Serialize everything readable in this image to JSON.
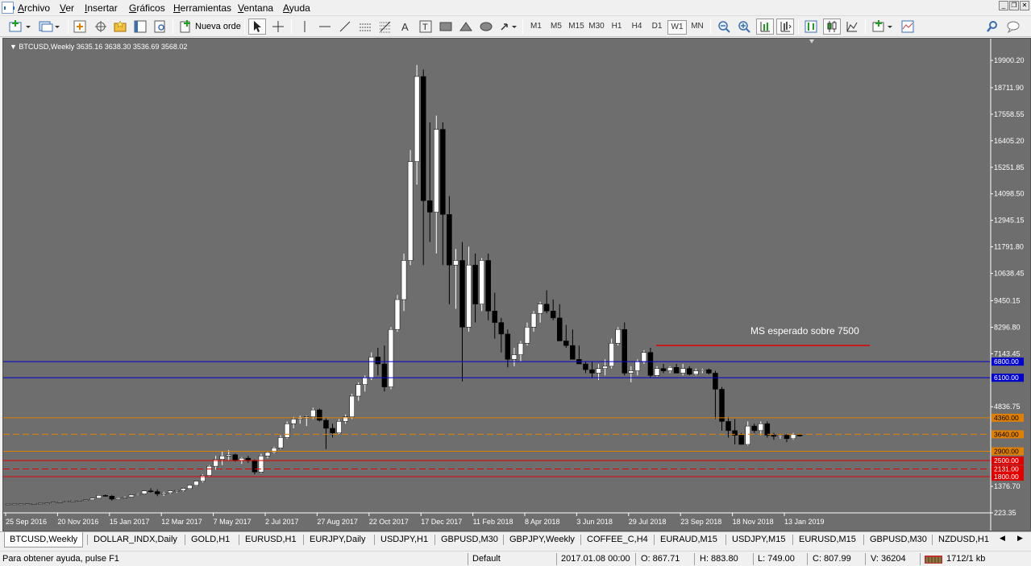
{
  "menu": [
    "Archivo",
    "Ver",
    "Insertar",
    "Gráficos",
    "Herramientas",
    "Ventana",
    "Ayuda"
  ],
  "toolbar": {
    "new_order_label": "Nueva orde",
    "timeframes": [
      "M1",
      "M5",
      "M15",
      "M30",
      "H1",
      "H4",
      "D1",
      "W1",
      "MN"
    ],
    "active_timeframe": "W1"
  },
  "chart": {
    "header": "BTCUSD,Weekly  3635.16 3638.30 3536.69 3568.02",
    "annotation": "MS esperado sobre 7500",
    "bg_color": "#6e6e6e",
    "up_color": "#ffffff",
    "down_color": "#000000",
    "badges": [
      {
        "text": "6800.00",
        "value": 6800,
        "color": "#0000cc"
      },
      {
        "text": "6100.00",
        "value": 6100,
        "color": "#0000cc"
      },
      {
        "text": "4360.00",
        "value": 4360,
        "color": "#e08000"
      },
      {
        "text": "3640.00",
        "value": 3640,
        "color": "#e08000"
      },
      {
        "text": "2900.00",
        "value": 2900,
        "color": "#e08000"
      },
      {
        "text": "2500.00",
        "value": 2500,
        "color": "#e00000"
      },
      {
        "text": "2131.00",
        "value": 2131,
        "color": "#e00000"
      },
      {
        "text": "1800.00",
        "value": 1800,
        "color": "#e00000"
      }
    ]
  },
  "chart_data": {
    "type": "candlestick",
    "symbol": "BTCUSD",
    "period": "Weekly",
    "ylim": [
      223.35,
      20400
    ],
    "y_ticks": [
      "19900.20",
      "18711.90",
      "17558.55",
      "16405.20",
      "15251.85",
      "14098.50",
      "12945.15",
      "11791.80",
      "10638.45",
      "9450.15",
      "8296.80",
      "7143.45",
      "4836.75",
      "1376.70",
      "223.35"
    ],
    "x_ticks": [
      "25 Sep 2016",
      "20 Nov 2016",
      "15 Jan 2017",
      "12 Mar 2017",
      "7 May 2017",
      "2 Jul 2017",
      "27 Aug 2017",
      "22 Oct 2017",
      "17 Dec 2017",
      "11 Feb 2018",
      "8 Apr 2018",
      "3 Jun 2018",
      "29 Jul 2018",
      "23 Sep 2018",
      "18 Nov 2018",
      "13 Jan 2019"
    ],
    "horizontal_lines": [
      {
        "value": 6800,
        "color": "#0000cc",
        "style": "solid"
      },
      {
        "value": 6100,
        "color": "#0000cc",
        "style": "solid"
      },
      {
        "value": 4360,
        "color": "#e08000",
        "style": "solid"
      },
      {
        "value": 3640,
        "color": "#e08000",
        "style": "dashed"
      },
      {
        "value": 2900,
        "color": "#e08000",
        "style": "solid"
      },
      {
        "value": 2500,
        "color": "#e00000",
        "style": "solid"
      },
      {
        "value": 2131,
        "color": "#e00000",
        "style": "dashed"
      },
      {
        "value": 1800,
        "color": "#e00000",
        "style": "solid"
      }
    ],
    "segment_level": 7500,
    "ohlc": [
      [
        605,
        610,
        600,
        608
      ],
      [
        608,
        615,
        603,
        612
      ],
      [
        612,
        618,
        605,
        614
      ],
      [
        614,
        620,
        608,
        616
      ],
      [
        616,
        640,
        612,
        630
      ],
      [
        630,
        650,
        620,
        645
      ],
      [
        645,
        660,
        635,
        650
      ],
      [
        650,
        690,
        645,
        685
      ],
      [
        685,
        720,
        675,
        700
      ],
      [
        700,
        740,
        690,
        730
      ],
      [
        730,
        760,
        720,
        745
      ],
      [
        745,
        780,
        730,
        770
      ],
      [
        770,
        800,
        750,
        790
      ],
      [
        790,
        870,
        780,
        860
      ],
      [
        860,
        1000,
        850,
        980
      ],
      [
        980,
        1020,
        930,
        950
      ],
      [
        950,
        1000,
        760,
        820
      ],
      [
        820,
        900,
        800,
        880
      ],
      [
        880,
        950,
        860,
        920
      ],
      [
        920,
        1020,
        900,
        1000
      ],
      [
        1000,
        1080,
        980,
        1050
      ],
      [
        1050,
        1190,
        1030,
        1180
      ],
      [
        1180,
        1290,
        1100,
        1150
      ],
      [
        1150,
        1250,
        950,
        1050
      ],
      [
        1050,
        1150,
        960,
        1100
      ],
      [
        1100,
        1200,
        1050,
        1180
      ],
      [
        1180,
        1220,
        1100,
        1200
      ],
      [
        1200,
        1300,
        1150,
        1280
      ],
      [
        1280,
        1450,
        1260,
        1420
      ],
      [
        1420,
        1620,
        1400,
        1600
      ],
      [
        1600,
        1900,
        1550,
        1850
      ],
      [
        1850,
        2300,
        1800,
        2250
      ],
      [
        2250,
        2700,
        2100,
        2550
      ],
      [
        2550,
        2900,
        2300,
        2700
      ],
      [
        2700,
        2950,
        2500,
        2750
      ],
      [
        2750,
        2800,
        2450,
        2500
      ],
      [
        2500,
        2650,
        2350,
        2600
      ],
      [
        2600,
        2700,
        2400,
        2500
      ],
      [
        2500,
        2550,
        1900,
        2000
      ],
      [
        2000,
        2800,
        1950,
        2700
      ],
      [
        2700,
        2900,
        2600,
        2850
      ],
      [
        2850,
        3100,
        2800,
        3050
      ],
      [
        3050,
        3600,
        3000,
        3500
      ],
      [
        3500,
        4200,
        3450,
        4100
      ],
      [
        4100,
        4400,
        3900,
        4300
      ],
      [
        4300,
        4450,
        4100,
        4350
      ],
      [
        4350,
        4450,
        4000,
        4400
      ],
      [
        4400,
        4800,
        4300,
        4700
      ],
      [
        4700,
        4760,
        4200,
        4250
      ],
      [
        4250,
        4350,
        3000,
        3900
      ],
      [
        3900,
        4100,
        3500,
        3700
      ],
      [
        3700,
        4300,
        3650,
        4200
      ],
      [
        4200,
        4500,
        4100,
        4400
      ],
      [
        4400,
        5400,
        4300,
        5300
      ],
      [
        5300,
        5900,
        5100,
        5800
      ],
      [
        5800,
        6200,
        5500,
        6100
      ],
      [
        6100,
        7200,
        6000,
        7000
      ],
      [
        7000,
        7400,
        6200,
        6700
      ],
      [
        6700,
        7500,
        5500,
        5700
      ],
      [
        5700,
        8300,
        5600,
        8200
      ],
      [
        8200,
        9700,
        8100,
        9500
      ],
      [
        9500,
        11500,
        9000,
        11200
      ],
      [
        11200,
        16000,
        11000,
        15500
      ],
      [
        15500,
        19700,
        14500,
        19200
      ],
      [
        19200,
        19500,
        11000,
        13800
      ],
      [
        13800,
        17200,
        12000,
        13300
      ],
      [
        13300,
        17500,
        11500,
        16900
      ],
      [
        16900,
        17200,
        11000,
        13200
      ],
      [
        13200,
        14000,
        9300,
        11000
      ],
      [
        11000,
        11700,
        9100,
        11200
      ],
      [
        11200,
        12000,
        5950,
        8300
      ],
      [
        8300,
        11800,
        8100,
        11000
      ],
      [
        11000,
        11500,
        8500,
        9300
      ],
      [
        9300,
        11300,
        9000,
        11200
      ],
      [
        11200,
        11500,
        8600,
        9000
      ],
      [
        9000,
        9800,
        7800,
        8500
      ],
      [
        8500,
        8700,
        7200,
        8000
      ],
      [
        8000,
        8200,
        6550,
        6900
      ],
      [
        6900,
        7400,
        6600,
        7100
      ],
      [
        7100,
        7700,
        6800,
        7600
      ],
      [
        7600,
        8500,
        7500,
        8300
      ],
      [
        8300,
        9000,
        8100,
        8900
      ],
      [
        8900,
        9400,
        8500,
        9300
      ],
      [
        9300,
        9900,
        8900,
        9000
      ],
      [
        9000,
        9500,
        8600,
        8700
      ],
      [
        8700,
        9300,
        8200,
        7700
      ],
      [
        7700,
        8400,
        7400,
        7500
      ],
      [
        7500,
        8200,
        7100,
        6900
      ],
      [
        6900,
        7500,
        6700,
        6700
      ],
      [
        6700,
        6800,
        6300,
        6450
      ],
      [
        6450,
        6800,
        6100,
        6300
      ],
      [
        6300,
        6700,
        6000,
        6500
      ],
      [
        6500,
        6900,
        6200,
        6600
      ],
      [
        6600,
        7800,
        6500,
        7600
      ],
      [
        7600,
        8300,
        7500,
        8200
      ],
      [
        8200,
        8500,
        6200,
        6300
      ],
      [
        6300,
        6600,
        5900,
        6400
      ],
      [
        6400,
        6900,
        6200,
        6800
      ],
      [
        6800,
        7300,
        6700,
        7200
      ],
      [
        7200,
        7400,
        6100,
        6200
      ],
      [
        6200,
        6600,
        6150,
        6500
      ],
      [
        6500,
        6700,
        6300,
        6400
      ],
      [
        6400,
        6600,
        6300,
        6550
      ],
      [
        6550,
        6700,
        6300,
        6300
      ],
      [
        6300,
        6700,
        6200,
        6500
      ],
      [
        6500,
        6600,
        6200,
        6250
      ],
      [
        6250,
        6500,
        6200,
        6400
      ],
      [
        6400,
        6500,
        6300,
        6450
      ],
      [
        6450,
        6500,
        6250,
        6300
      ],
      [
        6300,
        6400,
        4300,
        5600
      ],
      [
        5600,
        5700,
        3800,
        4200
      ],
      [
        4200,
        4400,
        3500,
        3800
      ],
      [
        3800,
        4300,
        3200,
        3600
      ],
      [
        3600,
        3700,
        3300,
        3200
      ],
      [
        3200,
        4200,
        3150,
        4000
      ],
      [
        4000,
        4100,
        3700,
        3800
      ],
      [
        3800,
        4200,
        3600,
        4100
      ],
      [
        4100,
        4200,
        3500,
        3600
      ],
      [
        3600,
        3700,
        3400,
        3550
      ],
      [
        3550,
        3650,
        3450,
        3600
      ],
      [
        3600,
        3650,
        3300,
        3450
      ],
      [
        3450,
        3700,
        3400,
        3640
      ],
      [
        3640,
        3650,
        3536,
        3568
      ]
    ]
  },
  "tabs": [
    "BTCUSD,Weekly",
    "DOLLAR_INDX,Daily",
    "GOLD,H1",
    "EURUSD,H1",
    "EURJPY,Daily",
    "USDJPY,H1",
    "GBPUSD,M30",
    "GBPJPY,Weekly",
    "COFFEE_C,H4",
    "EURAUD,M15",
    "USDJPY,M15",
    "EURUSD,M15",
    "GBPUSD,M30",
    "NZDUSD,H1"
  ],
  "status": {
    "help": "Para obtener ayuda, pulse F1",
    "profile": "Default",
    "datetime": "2017.01.08 00:00",
    "open": "O: 867.71",
    "high": "H: 883.80",
    "low": "L: 749.00",
    "close": "C: 807.99",
    "volume": "V: 36204",
    "traffic": "1712/1 kb"
  }
}
